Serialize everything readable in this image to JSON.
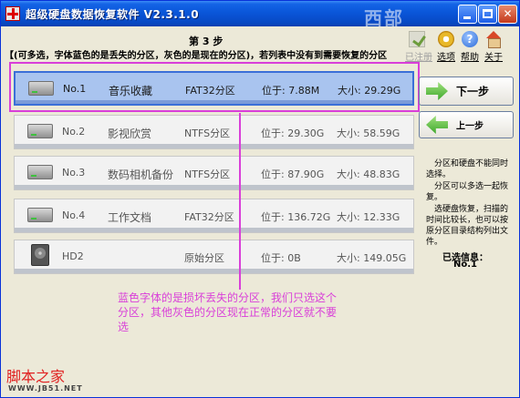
{
  "window": {
    "title": "超级硬盘数据恢复软件 V2.3.1.0",
    "watermark": "西部"
  },
  "header": {
    "step": "第 3 步",
    "instructions": "【(可多选，字体蓝色的是丢失的分区，灰色的是现在的分区)，若列表中没有到需要恢复的分区"
  },
  "toolbar": [
    {
      "label": "已注册",
      "icon": "check-icon",
      "enabled": false
    },
    {
      "label": "选项",
      "icon": "gear-icon",
      "enabled": true
    },
    {
      "label": "帮助",
      "icon": "help-icon",
      "enabled": true
    },
    {
      "label": "关于",
      "icon": "house-icon",
      "enabled": true
    }
  ],
  "partitions": [
    {
      "no": "No.1",
      "name": "音乐收藏",
      "fs": "FAT32分区",
      "pos": "位于: 7.88M",
      "size": "大小: 29.29G",
      "selected": true,
      "icon": "drive-icon"
    },
    {
      "no": "No.2",
      "name": "影视欣赏",
      "fs": "NTFS分区",
      "pos": "位于: 29.30G",
      "size": "大小: 58.59G",
      "selected": false,
      "icon": "drive-icon"
    },
    {
      "no": "No.3",
      "name": "数码相机备份",
      "fs": "NTFS分区",
      "pos": "位于: 87.90G",
      "size": "大小: 48.83G",
      "selected": false,
      "icon": "drive-icon"
    },
    {
      "no": "No.4",
      "name": "工作文档",
      "fs": "FAT32分区",
      "pos": "位于: 136.72G",
      "size": "大小: 12.33G",
      "selected": false,
      "icon": "drive-icon"
    },
    {
      "no": "HD2",
      "name": "",
      "fs": "原始分区",
      "pos": "位于: 0B",
      "size": "大小: 149.05G",
      "selected": false,
      "icon": "hard-disk-icon"
    }
  ],
  "buttons": {
    "next": "下一步",
    "prev": "上一步"
  },
  "help": [
    "分区和硬盘不能同时选择。",
    "分区可以多选一起恢复。",
    "选硬盘恢复，扫描的时间比较长，也可以按原分区目录结构列出文件。"
  ],
  "selection": {
    "label": "已选信息：",
    "value": "No.1"
  },
  "annotation": "蓝色字体的是损坏丢失的分区，我们只选这个分区，其他灰色的分区现在正常的分区就不要选",
  "footer": {
    "logo": "脚本之家",
    "url": "WWW.JB51.NET"
  },
  "colors": {
    "annotation": "#d93fd9",
    "selected_row": "#a9c4ef",
    "titlebar": "#0a56d9"
  }
}
